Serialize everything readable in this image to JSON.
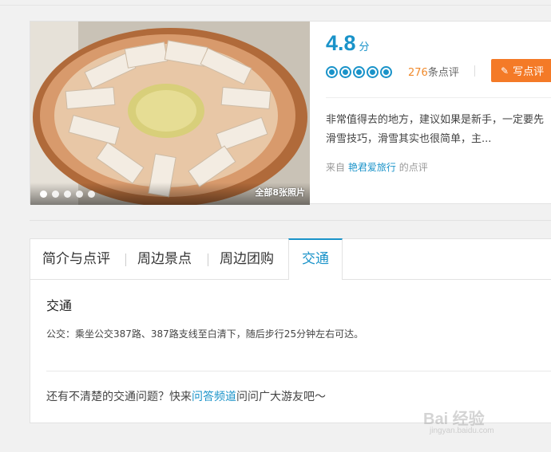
{
  "gallery": {
    "photo_count_label": "全部8张照片",
    "dots": 5,
    "active_dot": 0
  },
  "rating": {
    "score": "4.8",
    "unit": "分",
    "stars": 5,
    "review_count": "276",
    "review_suffix": "条点评",
    "write_button": "写点评",
    "write_icon": "pencil-icon"
  },
  "featured_review": {
    "line1": "非常值得去的地方，建议如果是新手，一定要先",
    "line2": "滑雪技巧，滑雪其实也很简单，主...",
    "source_prefix": "来自",
    "author": "艳君爱旅行",
    "source_suffix": "的点评"
  },
  "tabs": [
    {
      "label": "简介与点评",
      "active": false
    },
    {
      "label": "周边景点",
      "active": false
    },
    {
      "label": "周边团购",
      "active": false
    },
    {
      "label": "交通",
      "active": true
    }
  ],
  "transport": {
    "title": "交通",
    "bus_text": "公交：乘坐公交387路、387路支线至白清下，随后步行25分钟左右可达。",
    "question_prefix": "还有不清楚的交通问题？快来",
    "question_link": "问答频道",
    "question_suffix": "问问广大游友吧～"
  },
  "watermark": {
    "logo": "Bai 经验",
    "url": "jingyan.baidu.com"
  },
  "colors": {
    "accent_blue": "#1a93c9",
    "orange": "#f47a27",
    "count_orange": "#f08a2c"
  }
}
